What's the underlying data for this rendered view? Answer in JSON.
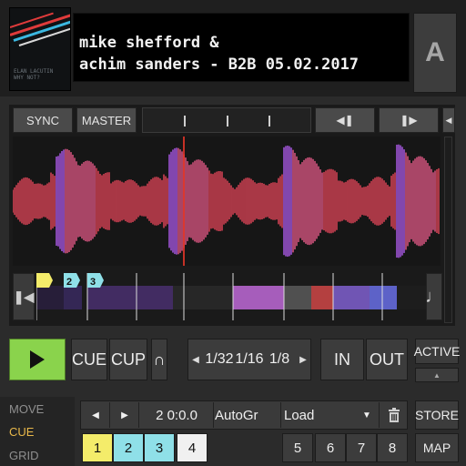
{
  "deck": {
    "letter": "A",
    "title": "mike shefford &\nachim sanders - B2B 05.02.2017",
    "cover_caption": "ELAN LACUTIN\nWHY NOT?"
  },
  "waveform_toolbar": {
    "sync_label": "SYNC",
    "master_label": "MASTER",
    "nav_back_icon": "skip-back-icon",
    "nav_fwd_icon": "skip-forward-icon",
    "scroll_icon": "caret-left-icon"
  },
  "cue_markers": [
    {
      "label": "2",
      "color": "#8fe0e8"
    },
    {
      "label": "3",
      "color": "#8fe0e8"
    }
  ],
  "transport": {
    "play_icon": "play-icon",
    "cue_label": "CUE",
    "cup_label": "CUP",
    "flux_label": "∩",
    "loop_sizes": [
      "1/32",
      "1/16",
      "1/8"
    ],
    "loop_left": "◀",
    "loop_right": "▶",
    "in_label": "IN",
    "out_label": "OUT",
    "active_label": "ACTIVE",
    "active_arrow": "▲"
  },
  "modes": {
    "items": [
      "MOVE",
      "CUE",
      "GRID"
    ],
    "selected": "CUE",
    "selected_color": "#e8b84a"
  },
  "cue_bar": {
    "prev": "◀",
    "next": "▶",
    "position": "2 0:0.0",
    "autogrid": "AutoGr",
    "type": "Load",
    "dropdown_arrow": "▼",
    "delete_icon": "trash-icon",
    "store_label": "STORE",
    "map_label": "MAP"
  },
  "hotcues": [
    {
      "label": "1",
      "color": "#f4ec6a",
      "active": true
    },
    {
      "label": "2",
      "color": "#8fe0e8",
      "active": true
    },
    {
      "label": "3",
      "color": "#8fe0e8",
      "active": true
    },
    {
      "label": "4",
      "color": "#f0f0f0",
      "active": true
    },
    {
      "label": "5",
      "active": false
    },
    {
      "label": "6",
      "active": false
    },
    {
      "label": "7",
      "active": false
    },
    {
      "label": "8",
      "active": false
    }
  ],
  "colors": {
    "play_green": "#8ad34c",
    "wave_red": "#e8465a",
    "wave_purple": "#b05cf0",
    "playhead": "#ff3a2a"
  }
}
